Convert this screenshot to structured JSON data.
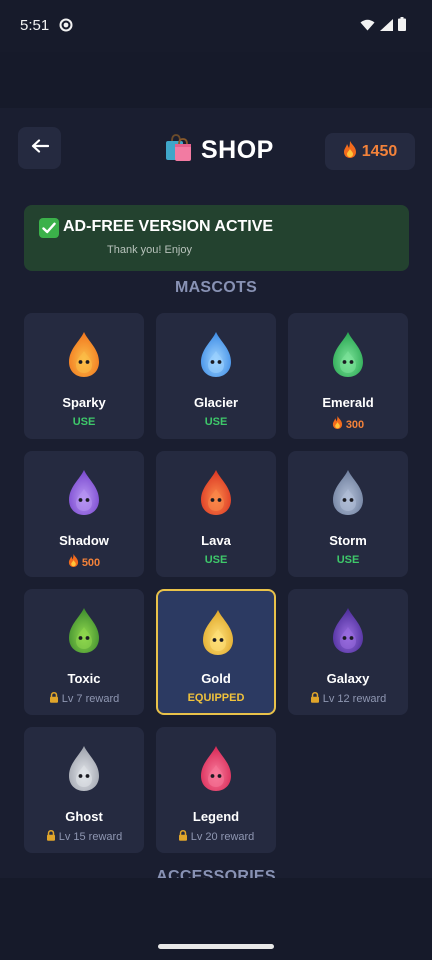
{
  "status_bar": {
    "time": "5:51"
  },
  "header": {
    "back_label": "←",
    "title": "SHOP",
    "title_icon": "shopping-bags-icon",
    "coins": "1450"
  },
  "banner": {
    "title": "AD-FREE VERSION ACTIVE",
    "subtitle": "Thank you! Enjoy"
  },
  "sections": {
    "mascots": "MASCOTS",
    "accessories": "ACCESSORIES"
  },
  "mascots": [
    {
      "name": "Sparky",
      "status": "USE",
      "kind": "use",
      "color": "#f2771f",
      "light": "#fbbf49"
    },
    {
      "name": "Glacier",
      "status": "USE",
      "kind": "use",
      "color": "#3f8de6",
      "light": "#9fd4ff"
    },
    {
      "name": "Emerald",
      "status": "300",
      "kind": "price",
      "color": "#2aa853",
      "light": "#7de39a"
    },
    {
      "name": "Shadow",
      "status": "500",
      "kind": "price",
      "color": "#7a49cf",
      "light": "#b896f3"
    },
    {
      "name": "Lava",
      "status": "USE",
      "kind": "use",
      "color": "#db3724",
      "light": "#fb8a4a"
    },
    {
      "name": "Storm",
      "status": "USE",
      "kind": "use",
      "color": "#6f7f9e",
      "light": "#b3c0d8"
    },
    {
      "name": "Toxic",
      "status": "Lv 7 reward",
      "kind": "locked",
      "color": "#3f8d2e",
      "light": "#8fd84e"
    },
    {
      "name": "Gold",
      "status": "EQUIPPED",
      "kind": "equipped",
      "color": "#e0a92c",
      "light": "#ffe17a"
    },
    {
      "name": "Galaxy",
      "status": "Lv 12 reward",
      "kind": "locked",
      "color": "#4c2d9a",
      "light": "#9a6ee0"
    },
    {
      "name": "Ghost",
      "status": "Lv 15 reward",
      "kind": "locked",
      "color": "#9fa3ad",
      "light": "#e2e5ea"
    },
    {
      "name": "Legend",
      "status": "Lv 20 reward",
      "kind": "locked",
      "color": "#d92a57",
      "light": "#f77a9b"
    }
  ],
  "colors": {
    "use": "#3ec86a",
    "price": "#f3823a",
    "locked": "#8f97b2",
    "equipped": "#f0c23c",
    "equipped_border": "#e9c24a"
  }
}
